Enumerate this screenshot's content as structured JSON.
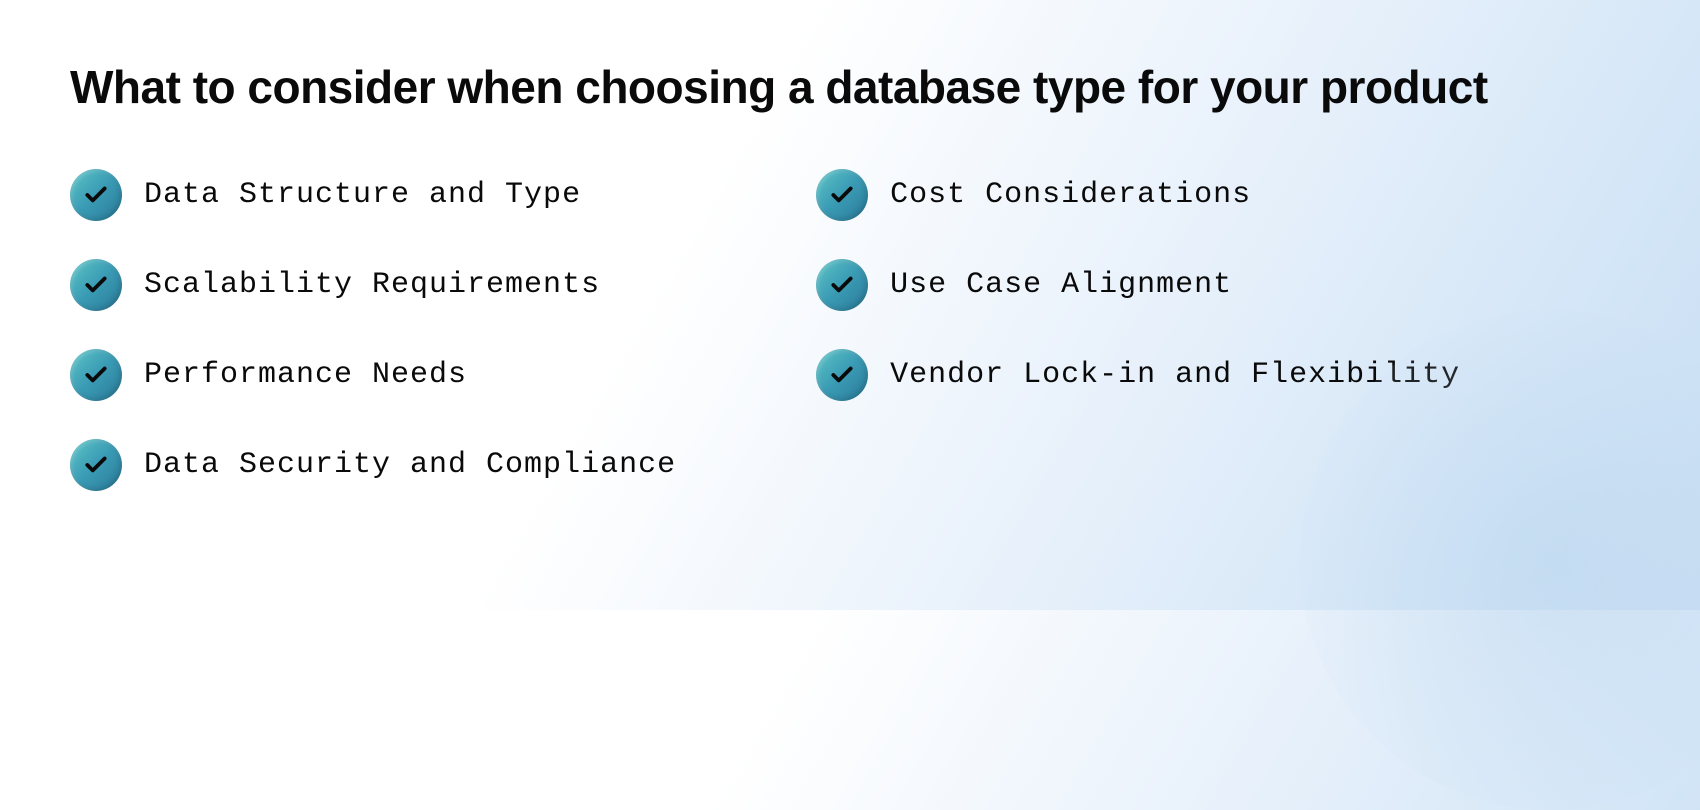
{
  "heading": "What to consider when choosing a database type for your product",
  "columns": {
    "left": [
      "Data Structure and Type",
      "Scalability Requirements",
      "Performance Needs",
      "Data Security and Compliance"
    ],
    "right": [
      "Cost Considerations",
      "Use Case Alignment",
      "Vendor Lock-in and Flexibility"
    ]
  }
}
